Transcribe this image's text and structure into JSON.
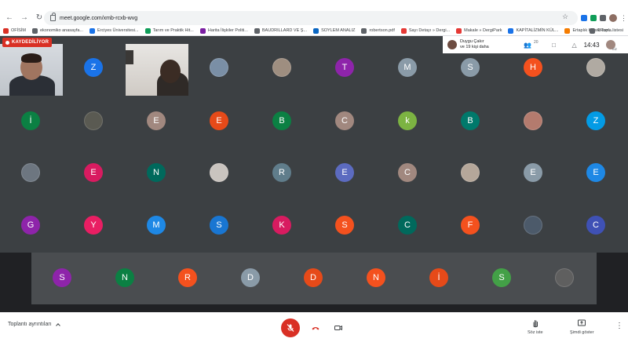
{
  "browser": {
    "url": "meet.google.com/xmb-rcxb-wvg",
    "bookmarks": [
      {
        "label": "OFİSİM",
        "color": "#d93025"
      },
      {
        "label": "ekonomiko anasayfa...",
        "color": "#5f6368"
      },
      {
        "label": "Erciyes Üniversitesi...",
        "color": "#1a73e8"
      },
      {
        "label": "Tarım ve Praktik Hit...",
        "color": "#0f9d58"
      },
      {
        "label": "Harita İlişkiler Politi...",
        "color": "#7b1fa2"
      },
      {
        "label": "BAUDRILLARD VE Ş...",
        "color": "#5f6368"
      },
      {
        "label": "SOYLEM ANALIZ",
        "color": "#0a66c2"
      },
      {
        "label": "robertson.pdf",
        "color": "#5f6368"
      },
      {
        "label": "Sayı Detayı » Dergi...",
        "color": "#e53935"
      },
      {
        "label": "Makale » DergiPark",
        "color": "#e53935"
      },
      {
        "label": "KAPİTALİZMİN KÜL...",
        "color": "#1a73e8"
      },
      {
        "label": "Ertaplık Klasik Topl...",
        "color": "#f57c00"
      }
    ],
    "reading_list": "Okuma listesi"
  },
  "meeting": {
    "recording_label": "KAYDEDİLİYOR",
    "presenter_name": "Duygu Çakır",
    "presenter_more": "ve 19 kişi daha",
    "participant_count": "20",
    "time": "14:43",
    "me_label": "Siz"
  },
  "grid": {
    "row1": [
      {
        "letter": "Z",
        "color": "#1a73e8"
      },
      {
        "letter": "",
        "color": "#7a8fa6",
        "photo": true
      },
      {
        "letter": "",
        "color": "#9e8e80",
        "photo": true
      },
      {
        "letter": "T",
        "color": "#8e24aa"
      },
      {
        "letter": "M",
        "color": "#8a9ba8"
      },
      {
        "letter": "S",
        "color": "#8a9ba8"
      },
      {
        "letter": "H",
        "color": "#f4511e"
      },
      {
        "letter": "",
        "color": "#b0aaa2",
        "photo": true
      }
    ],
    "row2": [
      {
        "letter": "İ",
        "color": "#0b8043"
      },
      {
        "letter": "",
        "color": "#5a5a52",
        "photo": true
      },
      {
        "letter": "E",
        "color": "#a1887f"
      },
      {
        "letter": "E",
        "color": "#e64a19"
      },
      {
        "letter": "B",
        "color": "#0b8043"
      },
      {
        "letter": "C",
        "color": "#a1887f"
      },
      {
        "letter": "k",
        "color": "#7cb342"
      },
      {
        "letter": "B",
        "color": "#00796b"
      },
      {
        "letter": "",
        "color": "#b47b6e",
        "photo": true
      },
      {
        "letter": "Z",
        "color": "#039be5"
      }
    ],
    "row3": [
      {
        "letter": "",
        "color": "#6d7680",
        "photo": true
      },
      {
        "letter": "E",
        "color": "#d81b60"
      },
      {
        "letter": "N",
        "color": "#00695c"
      },
      {
        "letter": "",
        "color": "#c9c4bf",
        "photo": true
      },
      {
        "letter": "R",
        "color": "#607d8b"
      },
      {
        "letter": "E",
        "color": "#5c6bc0"
      },
      {
        "letter": "C",
        "color": "#a1887f"
      },
      {
        "letter": "",
        "color": "#b5a79a",
        "photo": true
      },
      {
        "letter": "E",
        "color": "#8a9ba8"
      },
      {
        "letter": "E",
        "color": "#1e88e5"
      }
    ],
    "row4": [
      {
        "letter": "G",
        "color": "#8e24aa"
      },
      {
        "letter": "Y",
        "color": "#e91e63"
      },
      {
        "letter": "M",
        "color": "#1e88e5"
      },
      {
        "letter": "S",
        "color": "#1976d2"
      },
      {
        "letter": "K",
        "color": "#d81b60"
      },
      {
        "letter": "S",
        "color": "#f4511e"
      },
      {
        "letter": "C",
        "color": "#00695c"
      },
      {
        "letter": "F",
        "color": "#f4511e"
      },
      {
        "letter": "",
        "color": "#4c5a6a",
        "photo": true
      },
      {
        "letter": "C",
        "color": "#3f51b5"
      }
    ],
    "row5": [
      {
        "letter": "S",
        "color": "#8e24aa"
      },
      {
        "letter": "N",
        "color": "#0b8043"
      },
      {
        "letter": "R",
        "color": "#f4511e"
      },
      {
        "letter": "D",
        "color": "#8a9ba8"
      },
      {
        "letter": "D",
        "color": "#e64a19"
      },
      {
        "letter": "N",
        "color": "#f4511e"
      },
      {
        "letter": "İ",
        "color": "#e64a19"
      },
      {
        "letter": "S",
        "color": "#43a047"
      },
      {
        "letter": "",
        "color": "#5f5f5f",
        "photo": true
      }
    ]
  },
  "bottom": {
    "details_label": "Toplantı ayrıntıları",
    "raise_hand_label": "Söz iste",
    "present_label": "Şimdi göster"
  }
}
